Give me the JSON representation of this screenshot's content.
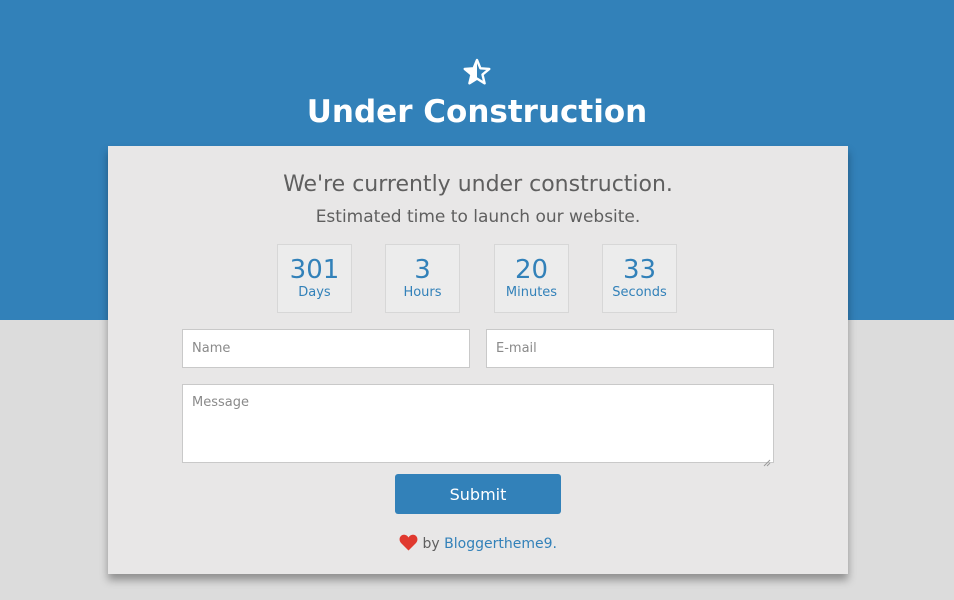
{
  "header": {
    "icon": "star-icon",
    "title": "Under Construction"
  },
  "card": {
    "heading": "We're currently under construction.",
    "subheading": "Estimated time to launch our website."
  },
  "countdown": [
    {
      "value": "301",
      "unit": "Days"
    },
    {
      "value": "3",
      "unit": "Hours"
    },
    {
      "value": "20",
      "unit": "Minutes"
    },
    {
      "value": "33",
      "unit": "Seconds"
    }
  ],
  "form": {
    "name_placeholder": "Name",
    "email_placeholder": "E-mail",
    "message_placeholder": "Message",
    "submit_label": "Submit"
  },
  "footer": {
    "icon": "heart-icon",
    "by_text": "by",
    "link_text": "Bloggertheme9."
  },
  "colors": {
    "accent": "#3281b9",
    "heart": "#e0392f",
    "card_background": "#e8e7e7",
    "page_background": "#dcdcdc"
  }
}
